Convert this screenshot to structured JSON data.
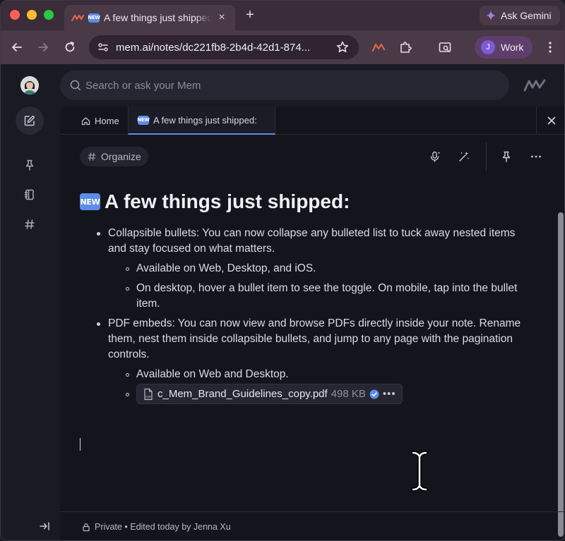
{
  "browser": {
    "tab_title": "A few things just shipped:",
    "tab_badge": "NEW",
    "new_tab_symbol": "+",
    "tab_close_symbol": "×",
    "ask_gemini_label": "Ask Gemini",
    "url": "mem.ai/notes/dc221fb8-2b4d-42d1-874...",
    "profile_initial": "J",
    "profile_label": "Work",
    "icons": [
      "back-arrow-icon",
      "forward-arrow-icon",
      "reload-icon",
      "site-settings-icon",
      "bookmark-star-icon",
      "mem-extension-icon",
      "extensions-puzzle-icon",
      "tab-search-icon",
      "kebab-menu-icon"
    ]
  },
  "app": {
    "search_placeholder": "Search or ask your Mem",
    "rail_icons": [
      "compose-icon",
      "pin-icon",
      "notebook-icon",
      "hashtag-icon",
      "collapse-sidebar-icon"
    ],
    "tabs": {
      "home_label": "Home",
      "note_label": "A few things just shipped:"
    },
    "toolbar": {
      "organize_label": "Organize",
      "icons": [
        "voice-icon",
        "magic-wand-icon",
        "pin-icon",
        "more-icon"
      ]
    },
    "note": {
      "badge": "NEW",
      "title": "A few things just shipped:",
      "bullets": [
        {
          "text": "Collapsible bullets: You can now collapse any bulleted list to tuck away nested items and stay focused on what matters.",
          "children": [
            "Available on Web, Desktop, and iOS.",
            "On desktop, hover a bullet item to see the toggle. On mobile, tap into the bullet item."
          ]
        },
        {
          "text": "PDF embeds: You can now view and browse PDFs directly inside your note. Rename them, nest them inside collapsible bullets, and jump to any page with the pagination controls.",
          "children": [
            "Available on Web and Desktop."
          ]
        }
      ],
      "attachment": {
        "filename": "c_Mem_Brand_Guidelines_copy.pdf",
        "size": "498 KB",
        "more_symbol": "•••"
      }
    },
    "footer": {
      "status": "Private • Edited today by Jenna Xu"
    },
    "colors": {
      "accent": "#5b8de8",
      "background": "#14141c",
      "browser_frame": "#4a3947"
    }
  }
}
